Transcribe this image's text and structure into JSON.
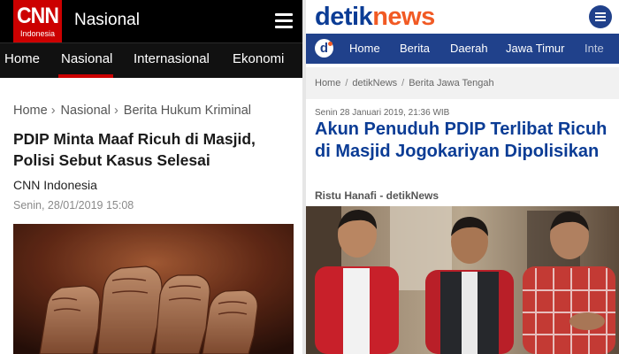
{
  "cnn": {
    "logo_text": "CNN",
    "logo_sub": "Indonesia",
    "section_title": "Nasional",
    "nav": [
      "Home",
      "Nasional",
      "Internasional",
      "Ekonomi"
    ],
    "breadcrumb": [
      "Home",
      "Nasional",
      "Berita Hukum Kriminal"
    ],
    "headline": "PDIP Minta Maaf Ricuh di Masjid, Polisi Sebut Kasus Selesai",
    "source": "CNN Indonesia",
    "date": "Senin, 28/01/2019 15:08",
    "colors": {
      "brand": "#cc0000",
      "header": "#000000"
    }
  },
  "detik": {
    "logo_part1": "detik",
    "logo_part2": "news",
    "nav_badge": "d",
    "nav": [
      "Home",
      "Berita",
      "Daerah",
      "Jawa Timur",
      "Inte"
    ],
    "breadcrumb": [
      "Home",
      "detikNews",
      "Berita Jawa Tengah"
    ],
    "date": "Senin 28 Januari 2019, 21:36 WIB",
    "headline": "Akun Penuduh PDIP Terlibat Ricuh di Masjid Jogokariyan Dipolisikan",
    "author": "Ristu Hanafi - detikNews",
    "colors": {
      "brand": "#20418b",
      "accent": "#f15a24"
    }
  }
}
